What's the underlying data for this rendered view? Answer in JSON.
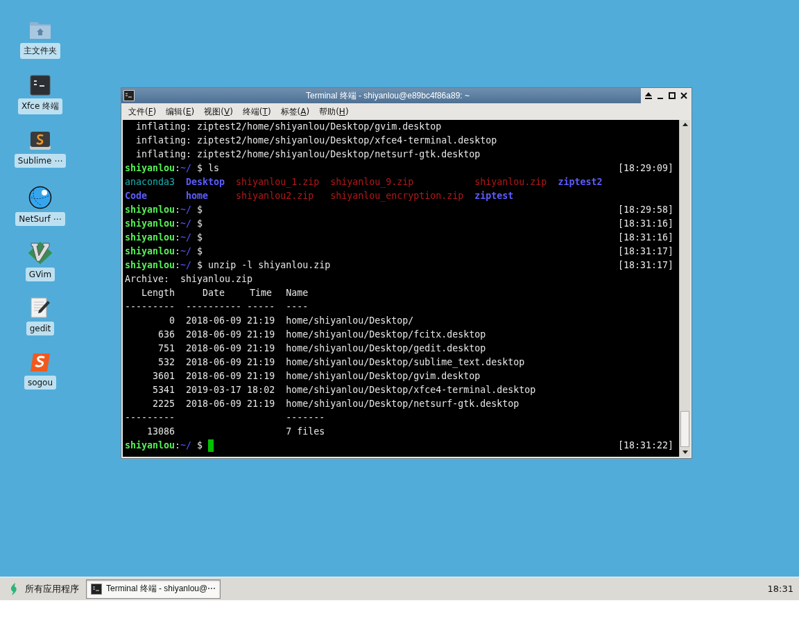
{
  "desktop_icons": [
    {
      "label": "主文件夹",
      "kind": "folder"
    },
    {
      "label": "Xfce 终端",
      "kind": "terminal"
    },
    {
      "label": "Sublime ⋯",
      "kind": "editor"
    },
    {
      "label": "NetSurf ⋯",
      "kind": "globe"
    },
    {
      "label": "GVim",
      "kind": "diamond"
    },
    {
      "label": "gedit",
      "kind": "notepad"
    },
    {
      "label": "sogou",
      "kind": "logo"
    }
  ],
  "window": {
    "title": "Terminal 终端 - shiyanlou@e89bc4f86a89: ~",
    "menu": [
      "文件(F)",
      "编辑(E)",
      "视图(V)",
      "终端(T)",
      "标签(A)",
      "帮助(H)"
    ],
    "terminal": {
      "lines": [
        {
          "kind": "indented",
          "text": "inflating: ziptest2/home/shiyanlou/Desktop/gvim.desktop"
        },
        {
          "kind": "indented",
          "text": "inflating: ziptest2/home/shiyanlou/Desktop/xfce4-terminal.desktop"
        },
        {
          "kind": "indented",
          "text": "inflating: ziptest2/home/shiyanlou/Desktop/netsurf-gtk.desktop"
        },
        {
          "kind": "prompt",
          "user": "shiyanlou",
          "separator": ":",
          "path": "~/",
          "symbol": "$",
          "command": "ls",
          "time": "[18:29:09]"
        },
        {
          "kind": "listing",
          "items": [
            {
              "name": "anaconda3",
              "kind": "link"
            },
            {
              "name": "Desktop",
              "kind": "dir"
            },
            {
              "name": "shiyanlou_1.zip",
              "kind": "archive"
            },
            {
              "name": "shiyanlou_9.zip",
              "kind": "archive"
            },
            {
              "name": "shiyanlou.zip",
              "kind": "archive"
            },
            {
              "name": "ziptest2",
              "kind": "dir"
            }
          ]
        },
        {
          "kind": "listing",
          "items": [
            {
              "name": "Code",
              "kind": "dir"
            },
            {
              "name": "home",
              "kind": "dir"
            },
            {
              "name": "shiyanlou2.zip",
              "kind": "archive"
            },
            {
              "name": "shiyanlou_encryption.zip",
              "kind": "archive"
            },
            {
              "name": "ziptest",
              "kind": "dir"
            }
          ]
        },
        {
          "kind": "prompt",
          "user": "shiyanlou",
          "separator": ":",
          "path": "~/",
          "symbol": "$",
          "time": "[18:29:58]"
        },
        {
          "kind": "prompt",
          "user": "shiyanlou",
          "separator": ":",
          "path": "~/",
          "symbol": "$",
          "time": "[18:31:16]"
        },
        {
          "kind": "prompt",
          "user": "shiyanlou",
          "separator": ":",
          "path": "~/",
          "symbol": "$",
          "time": "[18:31:16]"
        },
        {
          "kind": "prompt",
          "user": "shiyanlou",
          "separator": ":",
          "path": "~/",
          "symbol": "$",
          "time": "[18:31:17]"
        },
        {
          "kind": "prompt",
          "user": "shiyanlou",
          "separator": ":",
          "path": "~/",
          "symbol": "$",
          "command": "unzip -l shiyanlou.zip",
          "time": "[18:31:17]"
        },
        {
          "kind": "plain",
          "text": "Archive:  shiyanlou.zip"
        },
        {
          "kind": "table",
          "cells": [
            "Length",
            "Date",
            "Time",
            "Name"
          ]
        },
        {
          "kind": "table",
          "cells": [
            "---------",
            "----------",
            "-----",
            "----"
          ]
        },
        {
          "kind": "table",
          "cells": [
            "0",
            "2018-06-09",
            "21:19",
            "home/shiyanlou/Desktop/"
          ]
        },
        {
          "kind": "table",
          "cells": [
            "636",
            "2018-06-09",
            "21:19",
            "home/shiyanlou/Desktop/fcitx.desktop"
          ]
        },
        {
          "kind": "table",
          "cells": [
            "751",
            "2018-06-09",
            "21:19",
            "home/shiyanlou/Desktop/gedit.desktop"
          ]
        },
        {
          "kind": "table",
          "cells": [
            "532",
            "2018-06-09",
            "21:19",
            "home/shiyanlou/Desktop/sublime_text.desktop"
          ]
        },
        {
          "kind": "table",
          "cells": [
            "3601",
            "2018-06-09",
            "21:19",
            "home/shiyanlou/Desktop/gvim.desktop"
          ]
        },
        {
          "kind": "table",
          "cells": [
            "5341",
            "2019-03-17",
            "18:02",
            "home/shiyanlou/Desktop/xfce4-terminal.desktop"
          ]
        },
        {
          "kind": "table",
          "cells": [
            "2225",
            "2018-06-09",
            "21:19",
            "home/shiyanlou/Desktop/netsurf-gtk.desktop"
          ]
        },
        {
          "kind": "table",
          "cells": [
            "---------",
            null,
            null,
            "-------"
          ]
        },
        {
          "kind": "table",
          "cells": [
            "13086",
            null,
            null,
            "7 files"
          ]
        },
        {
          "kind": "prompt",
          "user": "shiyanlou",
          "separator": ":",
          "path": "~/",
          "symbol": "$",
          "cursor": true,
          "time": "[18:31:22]"
        }
      ]
    }
  },
  "taskbar": {
    "start_label": "所有应用程序",
    "tasks": [
      {
        "label": "Terminal 终端 - shiyanlou@⋯",
        "selected": true
      }
    ],
    "clock": "18:31"
  }
}
